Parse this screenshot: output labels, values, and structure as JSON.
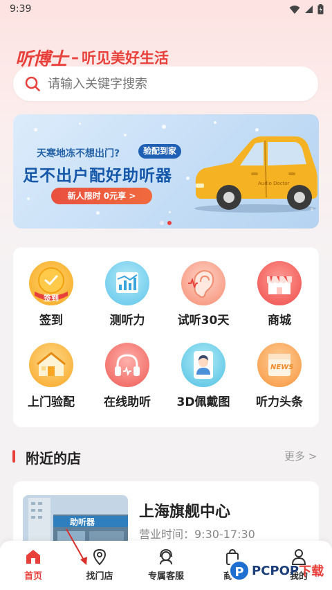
{
  "status_bar": {
    "time": "9:39"
  },
  "brand": {
    "logo": "听博士",
    "slogan": "听见美好生活"
  },
  "search": {
    "placeholder": "请输入关键字搜索"
  },
  "banner": {
    "subtitle": "天寒地冻不想出门?",
    "pill": "验配到家",
    "title": "足不出户配好助听器",
    "cta": "新人限时 0元享 >",
    "car_badge": "Audio Doctor",
    "colors": {
      "accent": "#e8413b",
      "car": "#f5b324"
    }
  },
  "grid": {
    "items": [
      {
        "label": "签到",
        "icon": "checkin-coin-icon",
        "badge": "签到"
      },
      {
        "label": "测听力",
        "icon": "hearing-test-chart-icon"
      },
      {
        "label": "试听30天",
        "icon": "ear-icon"
      },
      {
        "label": "商城",
        "icon": "shop-icon"
      },
      {
        "label": "上门验配",
        "icon": "home-visit-icon"
      },
      {
        "label": "在线助听",
        "icon": "headphones-icon"
      },
      {
        "label": "3D佩戴图",
        "icon": "3d-wear-icon"
      },
      {
        "label": "听力头条",
        "icon": "news-icon",
        "badge": "NEWS"
      }
    ]
  },
  "nearby": {
    "title": "附近的店",
    "more": "更多 >",
    "store": {
      "name": "上海旗舰中心",
      "hours": "营业时间：9:30-17:30",
      "photo_sign": "助听器"
    }
  },
  "tabbar": {
    "items": [
      {
        "label": "首页",
        "icon": "home-icon",
        "active": true
      },
      {
        "label": "找门店",
        "icon": "location-pin-icon"
      },
      {
        "label": "专属客服",
        "icon": "customer-service-icon"
      },
      {
        "label": "商城",
        "icon": "shopping-bag-icon"
      },
      {
        "label": "我的",
        "icon": "user-icon"
      }
    ]
  },
  "watermark": {
    "brand": "PCPOP",
    "suffix": "下载",
    "small": "PCPOP Download"
  }
}
